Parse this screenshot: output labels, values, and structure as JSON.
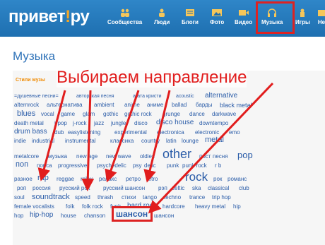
{
  "header": {
    "logo_main": "привет",
    "logo_bang": "!",
    "logo_tail": "ру",
    "nav": [
      {
        "label": "Сообщества",
        "icon": "people-icon"
      },
      {
        "label": "Люди",
        "icon": "person-icon"
      },
      {
        "label": "Блоги",
        "icon": "blog-icon"
      },
      {
        "label": "Фото",
        "icon": "photo-icon"
      },
      {
        "label": "Видео",
        "icon": "video-icon"
      },
      {
        "label": "Музыка",
        "icon": "headphones-icon"
      },
      {
        "label": "Игры",
        "icon": "games-icon"
      },
      {
        "label": "Не",
        "icon": "more-icon"
      }
    ],
    "active": "Музыка"
  },
  "page": {
    "title": "Музыка",
    "styles_label": "Стили музы"
  },
  "annotation": {
    "text": "Выбираем направление",
    "highlight_tag": "шансон",
    "color": "#e11d1d"
  },
  "tags": [
    "=душевные песни=",
    "авторская песня",
    "агата кристи",
    "acoustic",
    "alternative",
    "alternrock",
    "альтернатива",
    "ambient",
    "anime",
    "аниме",
    "ballad",
    "барды",
    "black metal",
    "blues",
    "vocal",
    "game",
    "glam",
    "gothic",
    "gothic rock",
    "grunge",
    "dance",
    "darkwave",
    "death metal",
    "j-pop",
    "j-rock",
    "jazz",
    "jungle",
    "disco",
    "disco house",
    "downtempo",
    "drum bass",
    "dub",
    "easylistening",
    "experimental",
    "electronica",
    "electronic",
    "emo",
    "indie",
    "industrial",
    "instrumental",
    "классика",
    "country",
    "latin",
    "lounge",
    "metal",
    "metalcore",
    "музыка",
    "new age",
    "new wave",
    "oldies",
    "other",
    "пост",
    "песня",
    "pop",
    "поп",
    "попса",
    "progressive",
    "psychedelic",
    "psy",
    "delic",
    "punk",
    "punk rock",
    "r b",
    "разное",
    "rap",
    "reggae",
    "relax",
    "релакс",
    "ретро",
    "retro",
    "rock",
    "рок",
    "романс",
    "роп",
    "россия",
    "русский рок",
    "русский шансон",
    "рэп",
    "celtic",
    "ska",
    "classical",
    "club",
    "soul",
    "soundtrack",
    "speed",
    "thrash",
    "стихи",
    "tango",
    "techno",
    "trance",
    "trip hop",
    "female vocalists",
    "folk",
    "folk rock",
    "funk",
    "hard rock",
    "hardcore",
    "heavy metal",
    "hip",
    "hop",
    "hip-hop",
    "house",
    "chanson",
    "шансон",
    "шансон"
  ]
}
